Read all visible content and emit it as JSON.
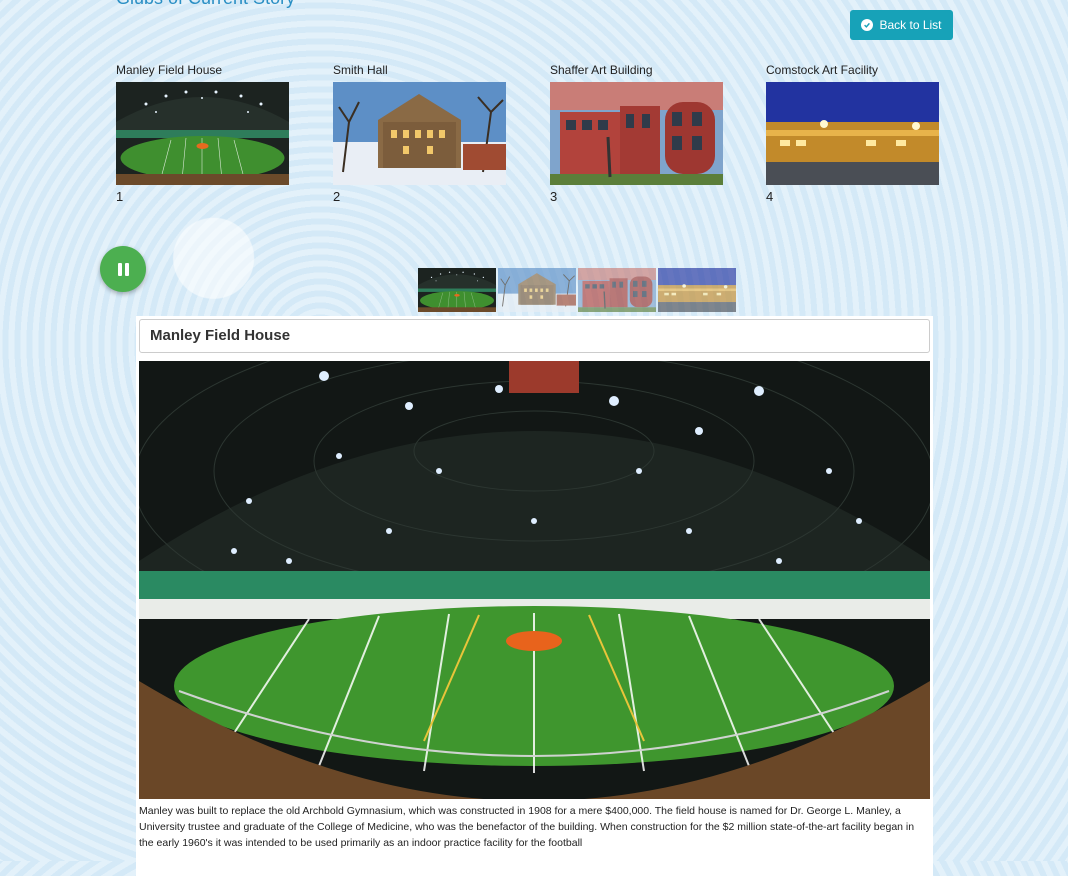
{
  "page": {
    "heading": "Glubs of Current Story"
  },
  "toolbar": {
    "back_label": "Back to List"
  },
  "thumbnails": [
    {
      "title": "Manley Field House",
      "number": "1"
    },
    {
      "title": "Smith Hall",
      "number": "2"
    },
    {
      "title": "Shaffer Art Building",
      "number": "3"
    },
    {
      "title": "Comstock Art Facility",
      "number": "4"
    }
  ],
  "slideshow": {
    "state": "playing",
    "control_icon": "pause-icon",
    "active_index": 1
  },
  "detail": {
    "title": "Manley Field House",
    "description": "Manley was built to replace the old Archbold Gymnasium, which was constructed in 1908 for a mere $400,000. The field house is named for Dr. George L. Manley, a University trustee and graduate of the College of Medicine, who was the benefactor of the building. When construction for the $2 million state-of-the-art facility began in the early 1960's it was intended to be used primarily as an indoor practice facility for the football"
  },
  "colors": {
    "accent": "#17a2b8",
    "play_button": "#4caf50",
    "heading": "#2a8fc4"
  }
}
